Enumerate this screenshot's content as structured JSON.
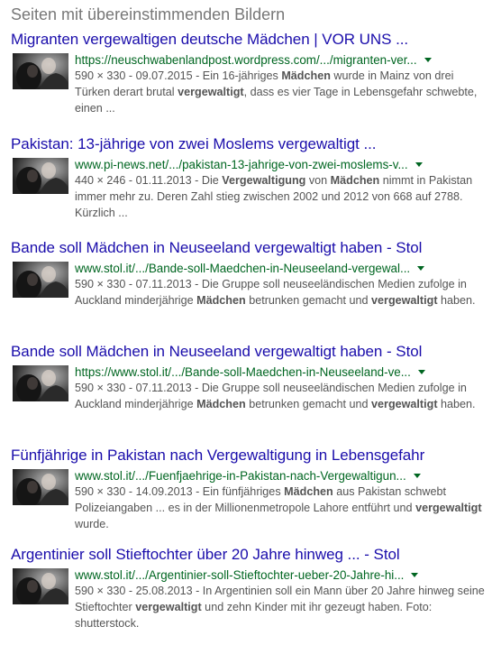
{
  "heading": "Seiten mit übereinstimmenden Bildern",
  "results": [
    {
      "title": "Migranten vergewaltigen deutsche Mädchen | VOR UNS ...",
      "url": "https://neuschwabenlandpost.wordpress.com/.../migranten-ver...",
      "meta": "590 × 330 - 09.07.2015",
      "snippet_parts": [
        {
          "t": " - Ein 16-jähriges ",
          "b": false
        },
        {
          "t": "Mädchen",
          "b": true
        },
        {
          "t": " wurde in Mainz von drei Türken derart brutal ",
          "b": false
        },
        {
          "t": "vergewaltigt",
          "b": true
        },
        {
          "t": ", dass es vier Tage in Lebensgefahr schwebte, einen ...",
          "b": false
        }
      ]
    },
    {
      "title": "Pakistan: 13-jährige von zwei Moslems vergewaltigt ...",
      "url": "www.pi-news.net/.../pakistan-13-jahrige-von-zwei-moslems-v...",
      "meta": "440 × 246 - 01.11.2013",
      "snippet_parts": [
        {
          "t": " - Die ",
          "b": false
        },
        {
          "t": "Vergewaltigung",
          "b": true
        },
        {
          "t": " von ",
          "b": false
        },
        {
          "t": "Mädchen",
          "b": true
        },
        {
          "t": " nimmt in Pakistan immer mehr zu. Deren Zahl stieg zwischen 2002 und 2012 von 668 auf 2788. Kürzlich ...",
          "b": false
        }
      ]
    },
    {
      "title": "Bande soll Mädchen in Neuseeland vergewaltigt haben - Stol",
      "url": "www.stol.it/.../Bande-soll-Maedchen-in-Neuseeland-vergewal...",
      "meta": "590 × 330 - 07.11.2013",
      "snippet_parts": [
        {
          "t": " - Die Gruppe soll neuseeländischen Medien zufolge in Auckland minderjährige ",
          "b": false
        },
        {
          "t": "Mädchen",
          "b": true
        },
        {
          "t": " betrunken gemacht und ",
          "b": false
        },
        {
          "t": "vergewaltigt",
          "b": true
        },
        {
          "t": " haben.",
          "b": false
        }
      ]
    },
    {
      "title": "Bande soll Mädchen in Neuseeland vergewaltigt haben - Stol",
      "url": "https://www.stol.it/.../Bande-soll-Maedchen-in-Neuseeland-ve...",
      "meta": "590 × 330 - 07.11.2013",
      "snippet_parts": [
        {
          "t": " - Die Gruppe soll neuseeländischen Medien zufolge in Auckland minderjährige ",
          "b": false
        },
        {
          "t": "Mädchen",
          "b": true
        },
        {
          "t": " betrunken gemacht und ",
          "b": false
        },
        {
          "t": "vergewaltigt",
          "b": true
        },
        {
          "t": " haben.",
          "b": false
        }
      ]
    },
    {
      "title": "Fünfjährige in Pakistan nach Vergewaltigung in Lebensgefahr",
      "url": "www.stol.it/.../Fuenfjaehrige-in-Pakistan-nach-Vergewaltigun...",
      "meta": "590 × 330 - 14.09.2013",
      "snippet_parts": [
        {
          "t": " - Ein fünfjähriges ",
          "b": false
        },
        {
          "t": "Mädchen",
          "b": true
        },
        {
          "t": " aus Pakistan schwebt Polizeiangaben ... es in der Millionenmetropole Lahore entführt und ",
          "b": false
        },
        {
          "t": "vergewaltigt",
          "b": true
        },
        {
          "t": " wurde.",
          "b": false
        }
      ]
    },
    {
      "title": "Argentinier soll Stieftochter über 20 Jahre hinweg ... - Stol",
      "url": "www.stol.it/.../Argentinier-soll-Stieftochter-ueber-20-Jahre-hi...",
      "meta": "590 × 330 - 25.08.2013",
      "snippet_parts": [
        {
          "t": " - In Argentinien soll ein Mann über 20 Jahre hinweg seine Stieftochter ",
          "b": false
        },
        {
          "t": "vergewaltigt",
          "b": true
        },
        {
          "t": " und zehn Kinder mit ihr gezeugt haben. Foto: shutterstock.",
          "b": false
        }
      ]
    }
  ]
}
